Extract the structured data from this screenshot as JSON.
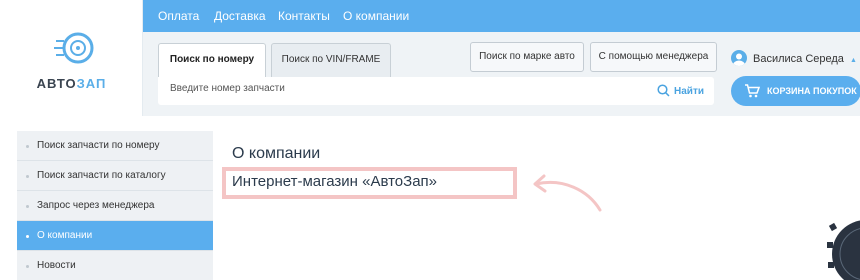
{
  "brand": {
    "part1": "АВТО",
    "part2": "ЗАП"
  },
  "topnav": [
    "Оплата",
    "Доставка",
    "Контакты",
    "О компании"
  ],
  "search": {
    "tab_active": "Поиск по номеру",
    "tab_inactive": "Поиск по VIN/FRAME",
    "placeholder": "Введите номер запчасти",
    "find_label": "Найти"
  },
  "header_buttons": {
    "by_brand": "Поиск по марке авто",
    "by_manager": "С помощью менеджера"
  },
  "user": {
    "name": "Василиса Середа"
  },
  "cart": {
    "label": "КОРЗИНА ПОКУПОК"
  },
  "sidebar": {
    "items": [
      {
        "label": "Поиск запчасти по номеру",
        "active": false
      },
      {
        "label": "Поиск запчасти по каталогу",
        "active": false
      },
      {
        "label": "Запрос через менеджера",
        "active": false
      },
      {
        "label": "О компании",
        "active": true
      },
      {
        "label": "Новости",
        "active": false
      }
    ]
  },
  "main": {
    "title": "О компании",
    "company_name": "Интернет-магазин «АвтоЗап»"
  },
  "colors": {
    "accent": "#5aaeee",
    "highlight_border": "#f4c5c5",
    "header_bg": "#eff3f6"
  }
}
